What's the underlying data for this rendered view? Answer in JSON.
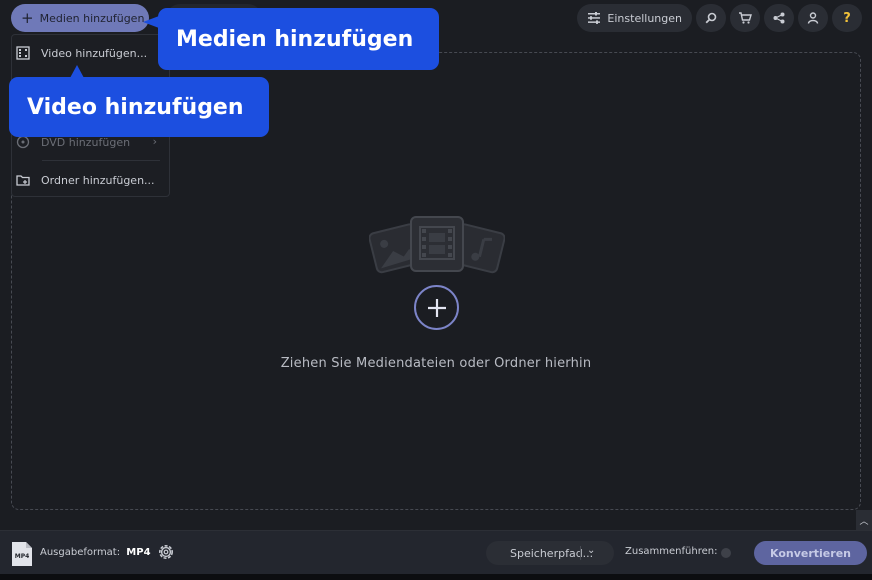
{
  "toolbar": {
    "add_media_label": "Medien hinzufügen",
    "settings_label": "Einstellungen",
    "help_label": "?",
    "icons": [
      "plus-icon",
      "sliders-icon",
      "search-icon",
      "cart-icon",
      "share-icon",
      "user-icon",
      "help-icon"
    ]
  },
  "menu": {
    "items": [
      {
        "label": "Video hinzufügen...",
        "icon": "video-add-icon",
        "enabled": true
      },
      {
        "label": "DVD hinzufügen",
        "icon": "dvd-icon",
        "enabled": false,
        "has_submenu": true
      },
      {
        "label": "Ordner hinzufügen...",
        "icon": "folder-add-icon",
        "enabled": true
      }
    ]
  },
  "callouts": {
    "media": "Medien hinzufügen",
    "video": "Video hinzufügen"
  },
  "dropzone": {
    "text": "Ziehen Sie Mediendateien oder Ordner hierhin"
  },
  "bottombar": {
    "format_icon_text": "MP4",
    "format_label": "Ausgabeformat:",
    "format_value": "MP4",
    "save_path_label": "Speicherpfad...",
    "merge_label": "Zusammenführen:",
    "convert_label": "Konvertieren"
  },
  "colors": {
    "background": "#1b1d22",
    "accent": "#6f79b8",
    "callout": "#1c4fe0",
    "help": "#f2c23a"
  }
}
